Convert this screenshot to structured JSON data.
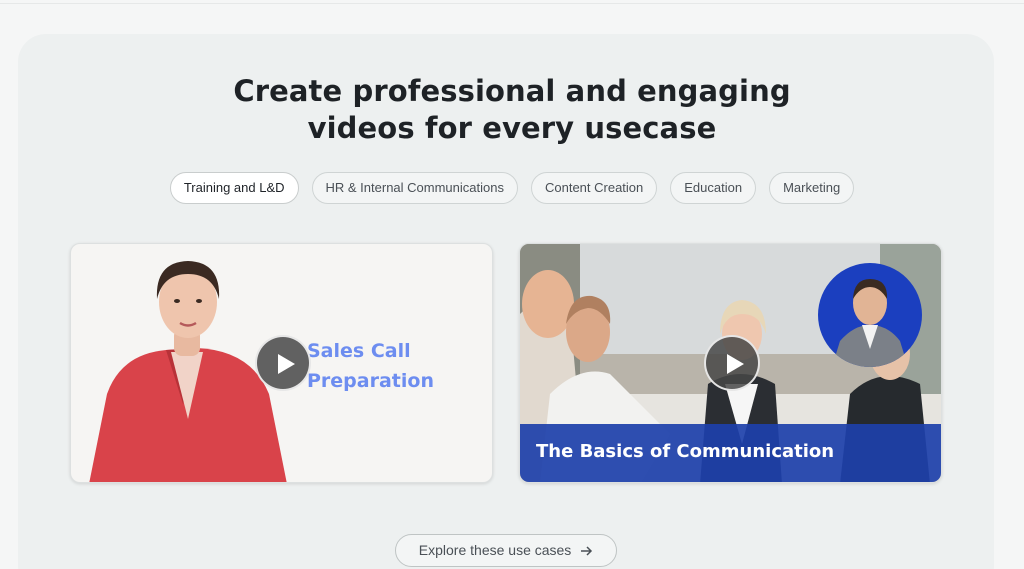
{
  "hero": {
    "headline_line1": "Create professional and engaging",
    "headline_line2": "videos for every usecase"
  },
  "tabs": [
    {
      "label": "Training and L&D",
      "active": true
    },
    {
      "label": "HR & Internal Communications",
      "active": false
    },
    {
      "label": "Content Creation",
      "active": false
    },
    {
      "label": "Education",
      "active": false
    },
    {
      "label": "Marketing",
      "active": false
    }
  ],
  "cards": [
    {
      "title_line1": "Sales Call",
      "title_line2": "Preparation",
      "icon": "play-icon"
    },
    {
      "title": "The Basics of Communication",
      "icon": "play-icon"
    }
  ],
  "cta": {
    "label": "Explore these use cases",
    "icon": "arrow-right-icon"
  },
  "colors": {
    "accent_blue": "#6d8df0",
    "banner_blue": "#1d40aa",
    "page_bg": "#f5f6f6",
    "panel_bg": "#edf0f0"
  }
}
